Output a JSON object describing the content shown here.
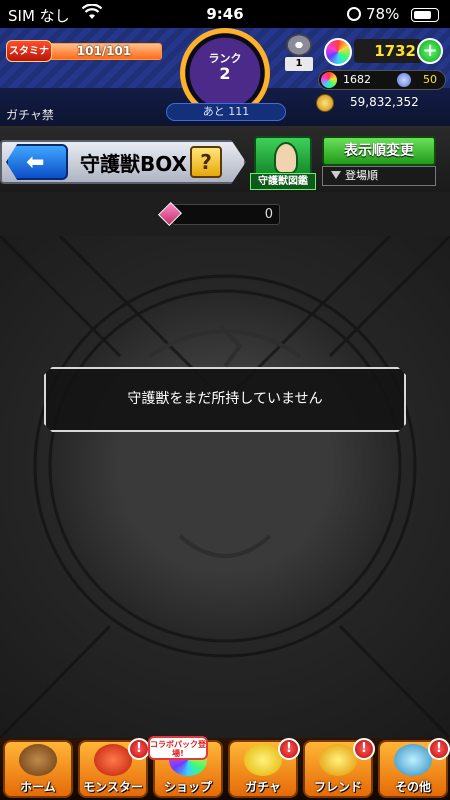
{
  "status_bar": {
    "carrier": "SIM なし",
    "time": "9:46",
    "battery_percent": "78%",
    "battery_level": 0.78
  },
  "header": {
    "stamina_tag": "スタミナ",
    "stamina_value": "101/101",
    "stamina_level": 1.0,
    "rank_label": "ランク",
    "rank_value": "2",
    "rank_remaining": "あと 111",
    "gacha_ban": "ガチャ禁",
    "ticket_count": "1",
    "orb_count": "1732",
    "plus_icon": "+",
    "orb_fragments": "1682",
    "fragment_alt": "50",
    "gold": "59,832,352"
  },
  "titlebar": {
    "back_icon": "⬅",
    "title": "守護獣BOX",
    "help_label": "?",
    "guardian_book_label": "守護獣図鑑",
    "sort_button_label": "表示順変更",
    "sort_value": "登場順"
  },
  "count_bar": {
    "owned_count": "0"
  },
  "main": {
    "empty_message": "守護獣をまだ所持していません"
  },
  "bottom_nav": {
    "collab_badge": "コラボパック登場!",
    "items": [
      {
        "label": "ホーム",
        "badge": ""
      },
      {
        "label": "モンスター",
        "badge": "!"
      },
      {
        "label": "ショップ",
        "badge": ""
      },
      {
        "label": "ガチャ",
        "badge": "!"
      },
      {
        "label": "フレンド",
        "badge": "!"
      },
      {
        "label": "その他",
        "badge": "!"
      }
    ]
  },
  "colors": {
    "header_blue": "#1d2b63",
    "accent_orange": "#ff9b2a",
    "nav_orange": "#ffb637",
    "sort_green": "#6ae05a",
    "orb_yellow": "#ffe22a"
  }
}
